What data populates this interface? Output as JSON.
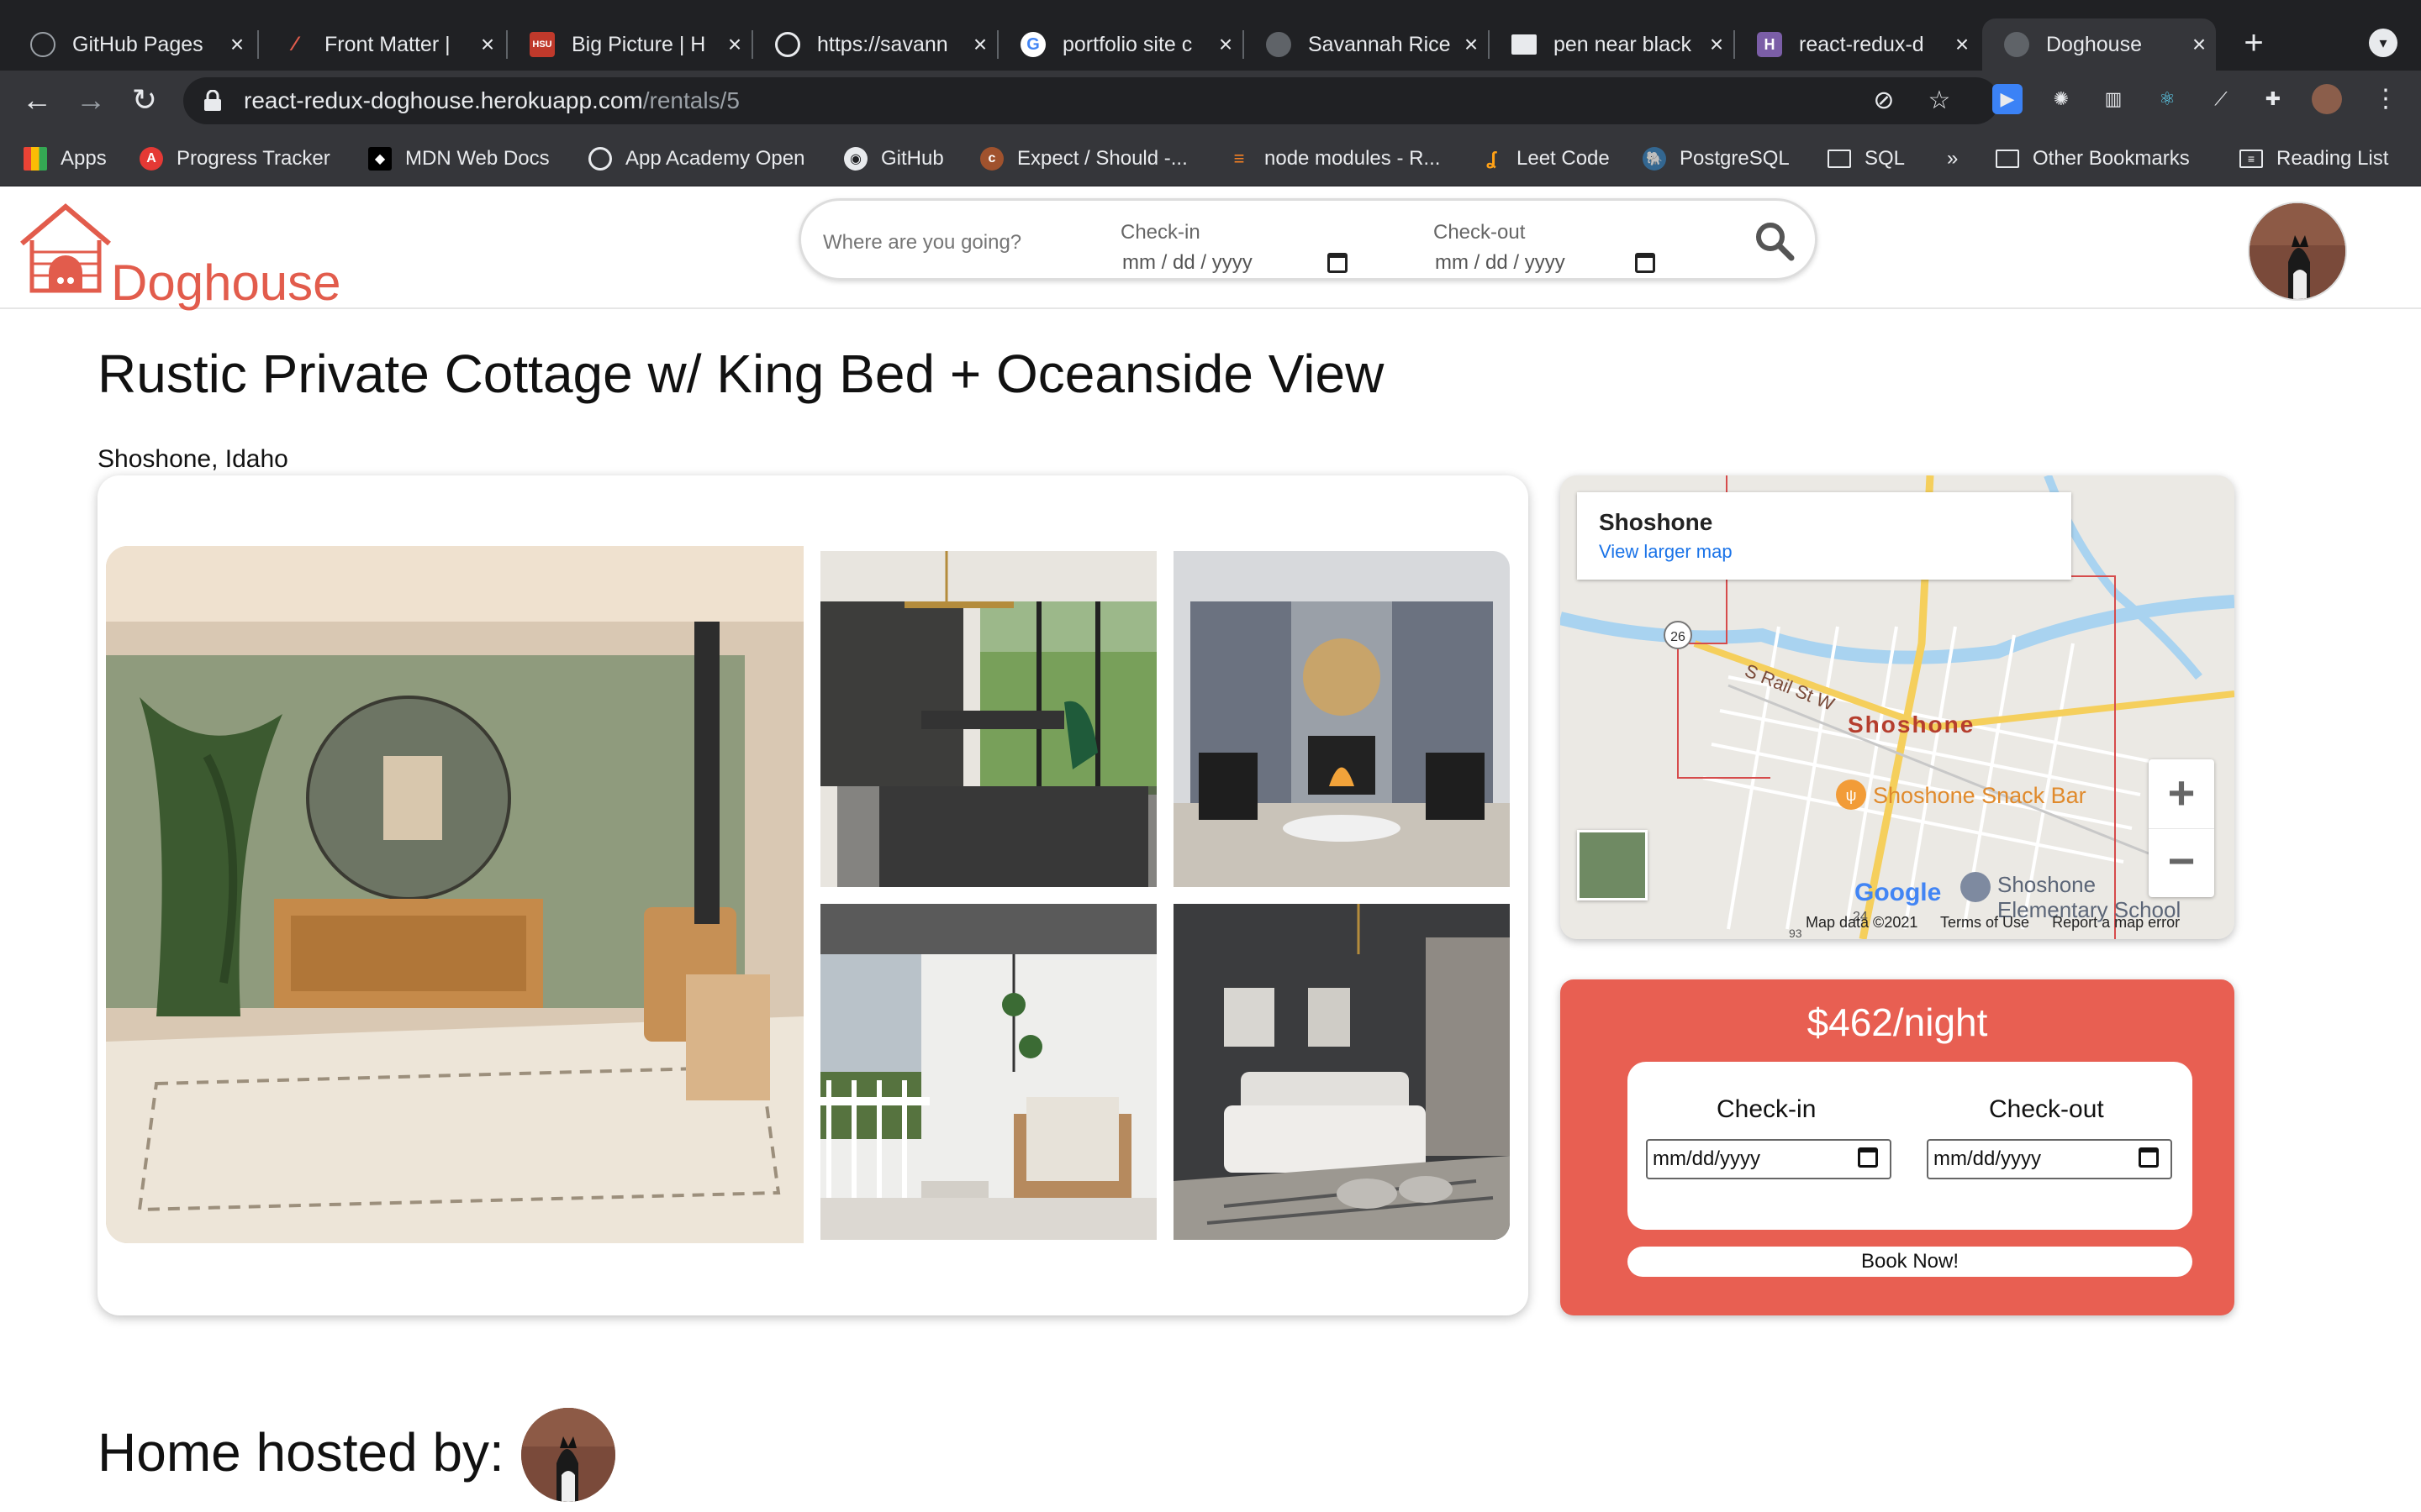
{
  "browser": {
    "tabs": [
      {
        "title": "GitHub Pages",
        "favicon": "github-icon",
        "color": "#202124"
      },
      {
        "title": "Front Matter |",
        "favicon": "pen-icon",
        "color": "#202124"
      },
      {
        "title": "Big Picture | H",
        "favicon": "hsu-icon",
        "color": "#c0392b"
      },
      {
        "title": "https://savann",
        "favicon": "globe-icon",
        "color": "#202124"
      },
      {
        "title": "portfolio site c",
        "favicon": "google-icon",
        "color": "#ffffff"
      },
      {
        "title": "Savannah Rice",
        "favicon": "globe-icon",
        "color": "#5f6368"
      },
      {
        "title": "pen near black",
        "favicon": "unsplash-icon",
        "color": "#202124"
      },
      {
        "title": "react-redux-d",
        "favicon": "heroku-icon",
        "color": "#7b5ea7"
      },
      {
        "title": "Doghouse",
        "favicon": "globe-icon",
        "color": "#5f6368",
        "active": true
      }
    ],
    "url": {
      "host": "react-redux-doghouse.herokuapp.com",
      "path": "/rentals/5"
    },
    "bookmarks": [
      {
        "label": "Apps",
        "icon": "apps-grid-icon"
      },
      {
        "label": "Progress Tracker",
        "icon": "app-academy-icon"
      },
      {
        "label": "MDN Web Docs",
        "icon": "mdn-icon"
      },
      {
        "label": "App Academy Open",
        "icon": "globe-icon"
      },
      {
        "label": "GitHub",
        "icon": "github-icon"
      },
      {
        "label": "Expect / Should -...",
        "icon": "chai-icon"
      },
      {
        "label": "node modules - R...",
        "icon": "stack-overflow-icon"
      },
      {
        "label": "Leet Code",
        "icon": "leetcode-icon"
      },
      {
        "label": "PostgreSQL",
        "icon": "postgres-icon"
      },
      {
        "label": "SQL",
        "icon": "folder-icon"
      },
      {
        "label": "»",
        "icon": "overflow-icon"
      },
      {
        "label": "Other Bookmarks",
        "icon": "folder-icon"
      },
      {
        "label": "Reading List",
        "icon": "reading-list-icon"
      }
    ]
  },
  "header": {
    "logo_text": "Doghouse",
    "search": {
      "placeholder": "Where are you going?",
      "checkin_label": "Check-in",
      "checkout_label": "Check-out",
      "date_placeholder": "mm / dd / yyyy"
    }
  },
  "listing": {
    "title": "Rustic Private Cottage w/ King Bed + Oceanside View",
    "location": "Shoshone, Idaho"
  },
  "map": {
    "place": "Shoshone",
    "larger_link": "View larger map",
    "labels": {
      "street": "S Rail St W",
      "town": "Shoshone",
      "poi_food": "Shoshone Snack Bar",
      "poi_school_1": "Shoshone",
      "poi_school_2": "Elementary School",
      "route_26": "26",
      "route_24": "24",
      "route_93": "93"
    },
    "google": "Google",
    "footer": [
      "Map data ©2021",
      "Terms of Use",
      "Report a map error"
    ]
  },
  "booking": {
    "price": "$462/night",
    "checkin_label": "Check-in",
    "checkout_label": "Check-out",
    "date_placeholder": "mm/dd/yyyy",
    "button": "Book Now!"
  },
  "host": {
    "heading": "Home hosted by:"
  },
  "colors": {
    "brand": "#e25c4c",
    "booking_bg": "#e85f52",
    "chrome_dark": "#202124",
    "chrome_mid": "#35363a"
  }
}
